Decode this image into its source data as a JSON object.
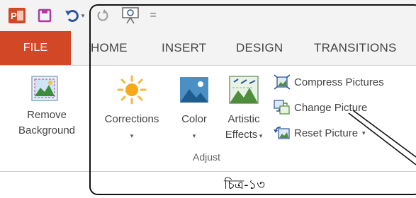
{
  "quick_access": {
    "items": [
      "powerpoint-logo",
      "save-icon",
      "undo-icon",
      "redo-icon",
      "start-slideshow-icon",
      "customize-qat-icon"
    ],
    "qat_more": "="
  },
  "tabs": [
    {
      "label": "FILE",
      "active": false
    },
    {
      "label": "HOME"
    },
    {
      "label": "INSERT"
    },
    {
      "label": "DESIGN"
    },
    {
      "label": "TRANSITIONS"
    }
  ],
  "ribbon": {
    "remove_background": {
      "line1": "Remove",
      "line2": "Background"
    },
    "corrections": {
      "label": "Corrections"
    },
    "color": {
      "label": "Color"
    },
    "artistic_effects": {
      "line1": "Artistic",
      "line2": "Effects"
    },
    "compress_pictures": "Compress Pictures",
    "change_picture": "Change Picture",
    "reset_picture": "Reset Picture",
    "group_label": "Adjust"
  },
  "caption": "চিত্র-১৩",
  "colors": {
    "file_tab": "#d24726",
    "ppt_red": "#d24726",
    "accent_blue": "#2b579a"
  }
}
